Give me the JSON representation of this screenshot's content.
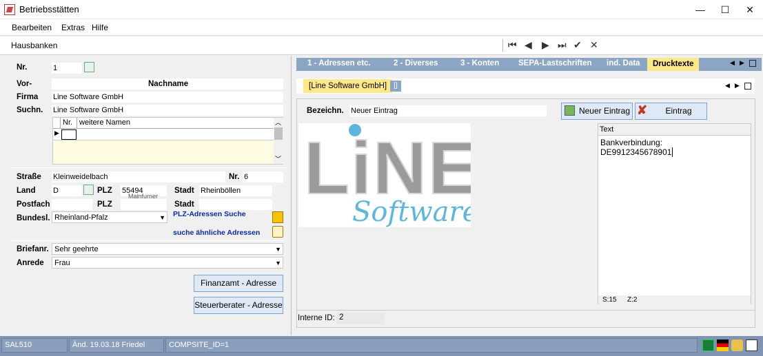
{
  "window": {
    "title": "Betriebsstätten",
    "minimize": "—",
    "maximize": "☐",
    "close": "✕"
  },
  "menu": {
    "items": [
      "Bearbeiten",
      "Extras",
      "Hilfe"
    ]
  },
  "toolbar": {
    "label": "Hausbanken",
    "nav": [
      "⏮",
      "◀",
      "▶",
      "⏭",
      "✔",
      "✕"
    ]
  },
  "form": {
    "nr_label": "Nr.",
    "nr_value": "1",
    "vor_label": "Vor-",
    "nachname_header": "Nachname",
    "firma_label": "Firma",
    "firma_value": "Line Software GmbH",
    "suchn_label": "Suchn.",
    "suchn_value": "Line Software GmbH",
    "names_grid": {
      "col_nr": "Nr.",
      "col_names": "weitere Namen"
    },
    "strasse_label": "Straße",
    "strasse_value": "Kleinweidelbach",
    "hnr_label": "Nr.",
    "hnr_value": "6",
    "land_label": "Land",
    "land_value": "D",
    "plz_label": "PLZ",
    "plz_value": "55494",
    "plz_hint": "Mainfurner",
    "stadt_label": "Stadt",
    "stadt_value": "Rheinböllen",
    "postfach_label": "Postfach",
    "postfach_value": "",
    "plz2_label": "PLZ",
    "plz2_value": "",
    "stadt2_label": "Stadt",
    "stadt2_value": "",
    "bundesl_label": "Bundesl.",
    "bundesl_value": "Rheinland-Pfalz",
    "plz_search_link": "PLZ-Adressen Suche",
    "similar_link": "suche ähnliche Adressen",
    "briefanr_label": "Briefanr.",
    "briefanr_value": "Sehr geehrte",
    "anrede_label": "Anrede",
    "anrede_value": "Frau",
    "finanzamt_button": "Finanzamt - Adresse",
    "steuerberater_button": "Steuerberater - Adresse"
  },
  "tabs": {
    "items": [
      "1 - Adressen etc.",
      "2 - Diverses",
      "3 - Konten",
      "SEPA-Lastschriften",
      "ind. Data",
      "Drucktexte"
    ],
    "active": "Drucktexte"
  },
  "subtabs": {
    "items": [
      "[Line Software GmbH]",
      "[]"
    ]
  },
  "druck": {
    "bezeichn_label": "Bezeichn.",
    "bezeichn_value": "Neuer Eintrag",
    "new_button": "Neuer Eintrag",
    "delete_button": "Eintrag löschen",
    "text_header": "Text",
    "text_lines": [
      "Bankverbindung:",
      "DE9912345678901"
    ],
    "status_s": "S:15",
    "status_z": "Z:2",
    "logo_word": "LiNE",
    "logo_script": "Software"
  },
  "interne_id": {
    "label": "Interne ID:",
    "value": "2"
  },
  "statusbar": {
    "seg1": "SAL510",
    "seg2": "Änd. 19.03.18 Friedel",
    "seg3": "COMPSITE_ID=1"
  },
  "colors": {
    "tab_bar": "#8da5c4",
    "tab_active": "#ffe88a",
    "status_bar": "#7f94b3",
    "link": "#0b2aa6",
    "button": "#dfe9f5",
    "logo_gray": "#9b9b9b",
    "logo_blue": "#5fb6dc"
  }
}
